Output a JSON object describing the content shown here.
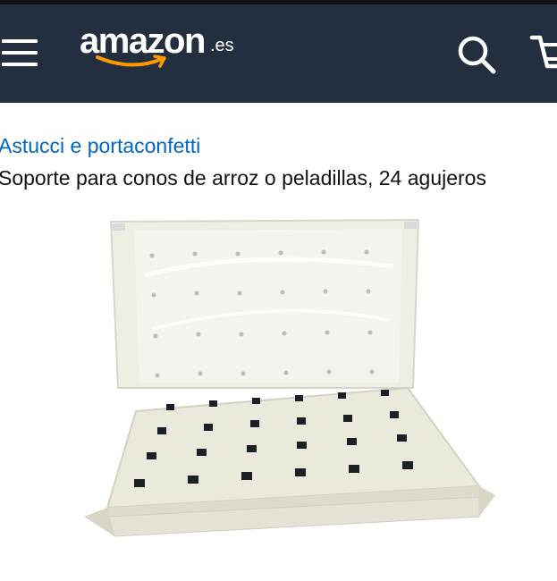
{
  "header": {
    "menu_icon": "hamburger-menu-icon",
    "logo_text": "amazon",
    "logo_tld": ".es",
    "search_icon": "search-icon",
    "cart_icon": "cart-icon",
    "colors": {
      "background": "#232f3e",
      "logo_smile": "#ff9900"
    }
  },
  "product": {
    "breadcrumb": "Astucci e portaconfetti",
    "title": "Soporte para conos de arroz o peladillas, 24 agujeros",
    "image_description": "cream cardboard holder with square holes"
  },
  "colors": {
    "link": "#0066c0",
    "text": "#0f1111"
  }
}
